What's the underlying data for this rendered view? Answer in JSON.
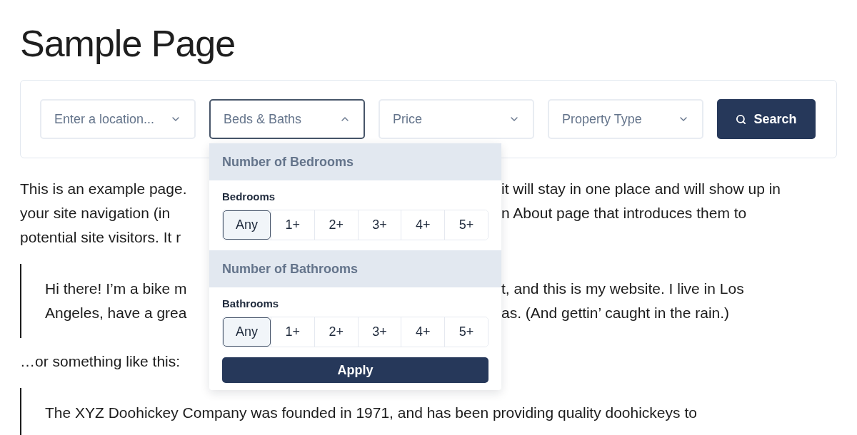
{
  "page_title": "Sample Page",
  "filters": [
    {
      "label": "Enter a location...",
      "expanded": false
    },
    {
      "label": "Beds & Baths",
      "expanded": true
    },
    {
      "label": "Price",
      "expanded": false
    },
    {
      "label": "Property Type",
      "expanded": false
    }
  ],
  "search_button": "Search",
  "dropdown": {
    "sections": [
      {
        "heading": "Number of Bedrooms",
        "label": "Bedrooms",
        "options": [
          {
            "label": "Any",
            "selected": true
          },
          {
            "label": "1+",
            "selected": false
          },
          {
            "label": "2+",
            "selected": false
          },
          {
            "label": "3+",
            "selected": false
          },
          {
            "label": "4+",
            "selected": false
          },
          {
            "label": "5+",
            "selected": false
          }
        ]
      },
      {
        "heading": "Number of Bathrooms",
        "label": "Bathrooms",
        "options": [
          {
            "label": "Any",
            "selected": true
          },
          {
            "label": "1+",
            "selected": false
          },
          {
            "label": "2+",
            "selected": false
          },
          {
            "label": "3+",
            "selected": false
          },
          {
            "label": "4+",
            "selected": false
          },
          {
            "label": "5+",
            "selected": false
          }
        ]
      }
    ],
    "apply": "Apply"
  },
  "blocks": [
    {
      "kind": "paragraph",
      "lines": [
        {
          "left": "This is an example page.",
          "right": "it will stay in one place and will show up in"
        },
        {
          "left": "your site navigation (in",
          "right": "n About page that introduces them to"
        },
        {
          "left": "potential site visitors. It r"
        }
      ]
    },
    {
      "kind": "quote",
      "lines": [
        {
          "left": "Hi there! I’m a bike m",
          "right": "t, and this is my website. I live in Los"
        },
        {
          "left": "Angeles, have a grea",
          "right": "as. (And gettin’ caught in the rain.)"
        }
      ]
    },
    {
      "kind": "paragraph",
      "lines": [
        {
          "full": "…or something like this:"
        }
      ]
    },
    {
      "kind": "quote",
      "lines": [
        {
          "full": "The XYZ Doohickey Company was founded in 1971, and has been providing quality doohickeys to"
        }
      ]
    }
  ]
}
